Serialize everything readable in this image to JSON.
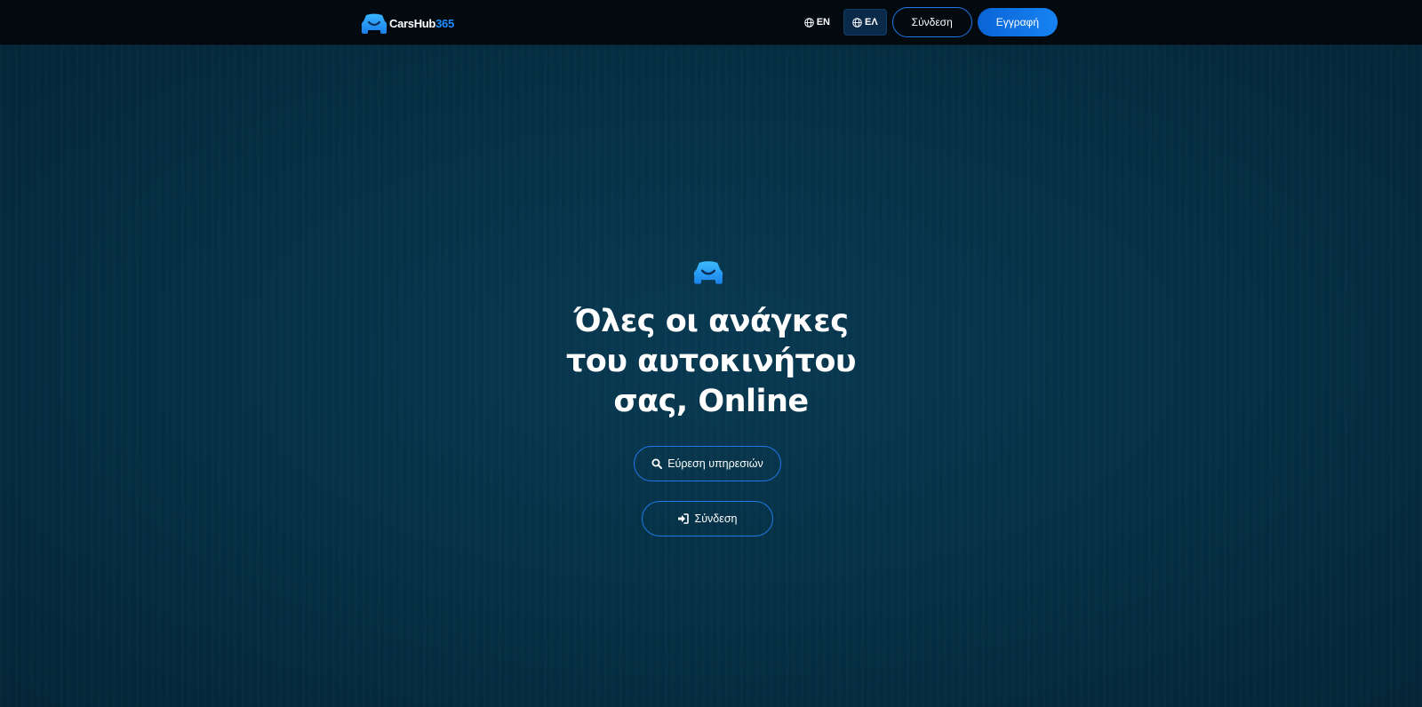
{
  "brand": {
    "name_main": "CarsHub",
    "name_accent": "365",
    "logo_icon": "smiling-car-icon",
    "accent_color": "#1e8fff"
  },
  "nav": {
    "lang_en": "EN",
    "lang_el": "ΕΛ",
    "active_lang": "ΕΛ",
    "login_label": "Σύνδεση",
    "register_label": "Εγγραφή"
  },
  "hero": {
    "title_lines": [
      "Όλες οι ανάγκες",
      "του αυτοκινήτου",
      "σας, Online"
    ],
    "find_services_label": "Εύρεση υπηρεσιών",
    "login_label": "Σύνδεση"
  },
  "colors": {
    "topbar": "#02090f",
    "background": "#063247",
    "primary": "#1783f3",
    "outline": "#1e78e6"
  }
}
